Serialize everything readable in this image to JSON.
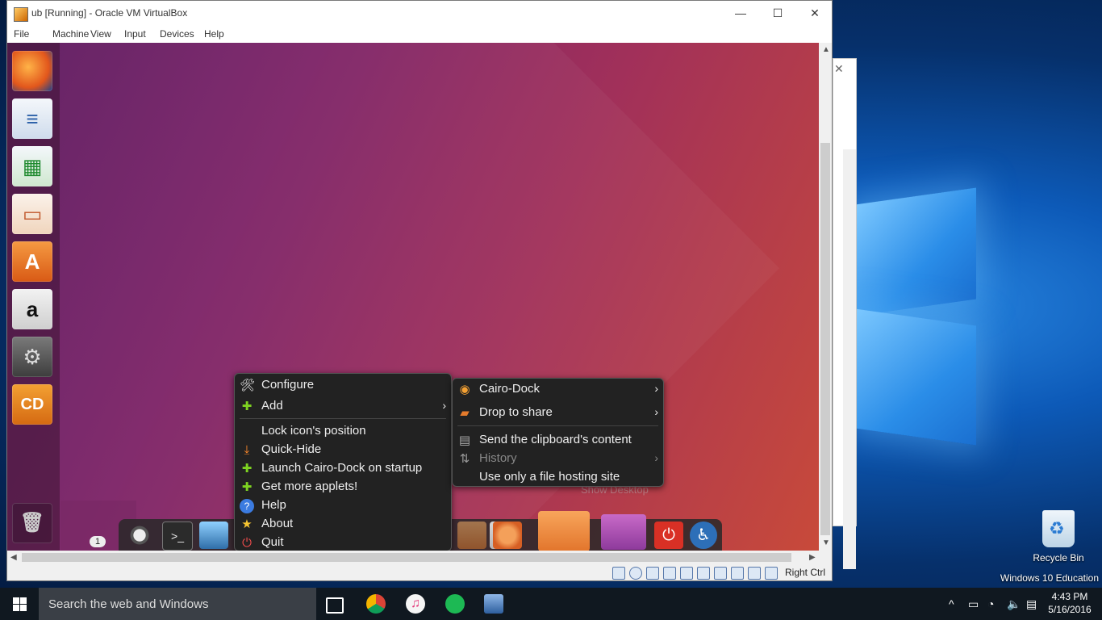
{
  "vbox": {
    "title": "ub [Running] - Oracle VM VirtualBox",
    "menu": [
      "File",
      "Machine",
      "View",
      "Input",
      "Devices",
      "Help"
    ],
    "host_key": "Right Ctrl"
  },
  "guest": {
    "workspace_number": "1",
    "show_desktop_label": "Show Desktop",
    "launcher": [
      "firefox-icon",
      "writer-icon",
      "calc-icon",
      "impress-icon",
      "software-center-icon",
      "amazon-icon",
      "system-settings-icon",
      "cairo-dock-icon",
      "trash-icon"
    ]
  },
  "context_menu": {
    "items": [
      {
        "label": "Configure"
      },
      {
        "label": "Add"
      },
      {
        "label": "Lock icon's position"
      },
      {
        "label": "Quick-Hide"
      },
      {
        "label": "Launch Cairo-Dock on startup"
      },
      {
        "label": "Get more applets!"
      },
      {
        "label": "Help"
      },
      {
        "label": "About"
      },
      {
        "label": "Quit"
      }
    ]
  },
  "submenu": {
    "items": [
      {
        "label": "Cairo-Dock"
      },
      {
        "label": "Drop to share"
      },
      {
        "label": "Send the clipboard's content"
      },
      {
        "label": "History"
      },
      {
        "label": "Use only a file hosting site"
      }
    ]
  },
  "desktop": {
    "recycle_bin_label": "Recycle Bin",
    "edition_label": "Windows 10 Education"
  },
  "taskbar": {
    "search_placeholder": "Search the web and Windows",
    "time": "4:43 PM",
    "date": "5/16/2016"
  }
}
